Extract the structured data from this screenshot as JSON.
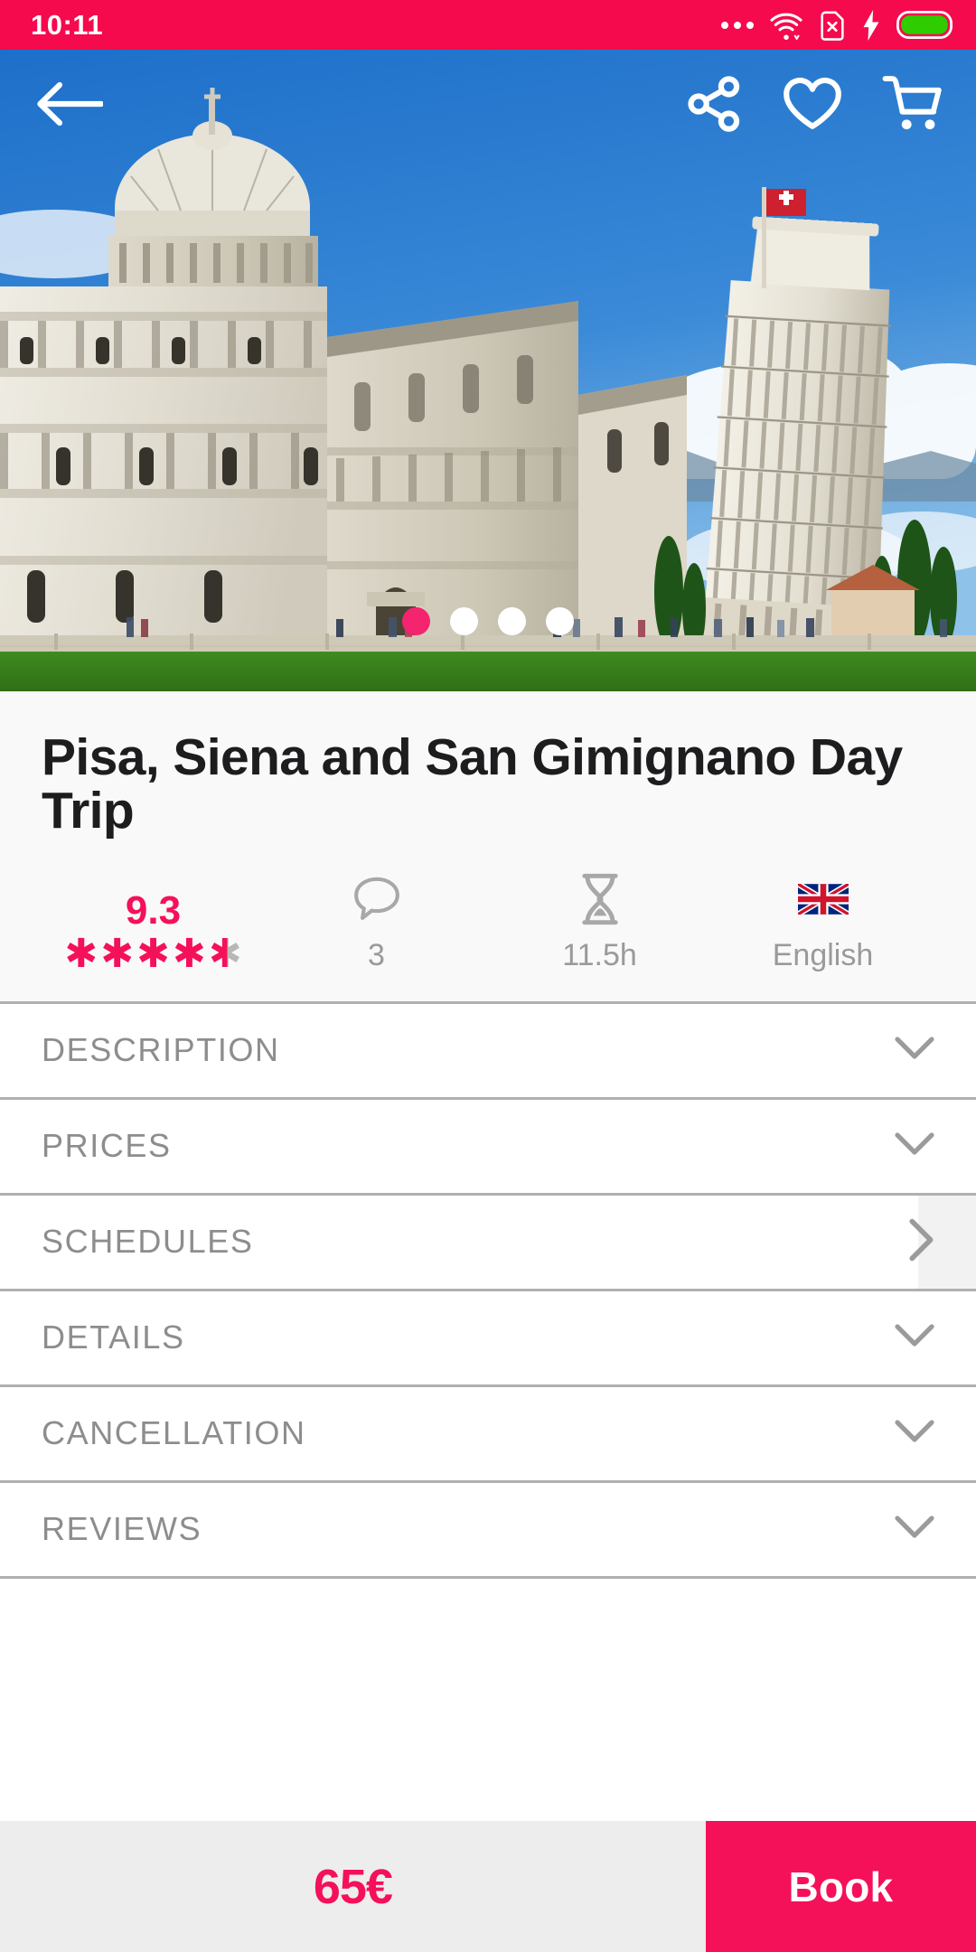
{
  "theme": {
    "accent": "#f5105a",
    "status_bar_bg": "#f50a4d",
    "panel_bg": "#f9f9f9",
    "divider": "#b0b0b0",
    "muted_text": "#8d8d8d",
    "price_pane_bg": "#ededed",
    "battery_green": "#2ecc00"
  },
  "status_bar": {
    "time": "10:11",
    "icons": [
      "more-dots-icon",
      "wifi-icon",
      "sim-card-error-icon",
      "charging-bolt-icon",
      "battery-full-icon"
    ]
  },
  "hero": {
    "back_icon": "arrow-left-icon",
    "actions": [
      {
        "name": "share-icon",
        "label": "Share"
      },
      {
        "name": "heart-icon",
        "label": "Favorite"
      },
      {
        "name": "cart-icon",
        "label": "Cart"
      }
    ],
    "carousel": {
      "total": 4,
      "active_index": 0
    },
    "alt": "Pisa Cathedral and the Leaning Tower of Pisa"
  },
  "product": {
    "title": "Pisa, Siena and San Gimignano Day Trip",
    "stats": [
      {
        "key": "rating",
        "value": "9.3",
        "icon": "star-rating-icon",
        "stars_filled": 4,
        "stars_total": 5
      },
      {
        "key": "reviews",
        "value": "3",
        "icon": "speech-bubble-icon"
      },
      {
        "key": "duration",
        "value": "11.5h",
        "icon": "hourglass-icon"
      },
      {
        "key": "language",
        "value": "English",
        "icon": "uk-flag-icon"
      }
    ]
  },
  "sections": [
    {
      "label": "DESCRIPTION",
      "chevron": "chevron-down-icon",
      "highlight": false
    },
    {
      "label": "PRICES",
      "chevron": "chevron-down-icon",
      "highlight": false
    },
    {
      "label": "SCHEDULES",
      "chevron": "chevron-right-icon",
      "highlight": true
    },
    {
      "label": "DETAILS",
      "chevron": "chevron-down-icon",
      "highlight": false
    },
    {
      "label": "CANCELLATION",
      "chevron": "chevron-down-icon",
      "highlight": false
    },
    {
      "label": "REVIEWS",
      "chevron": "chevron-down-icon",
      "highlight": false
    }
  ],
  "bottom_bar": {
    "price": "65€",
    "book_label": "Book"
  }
}
